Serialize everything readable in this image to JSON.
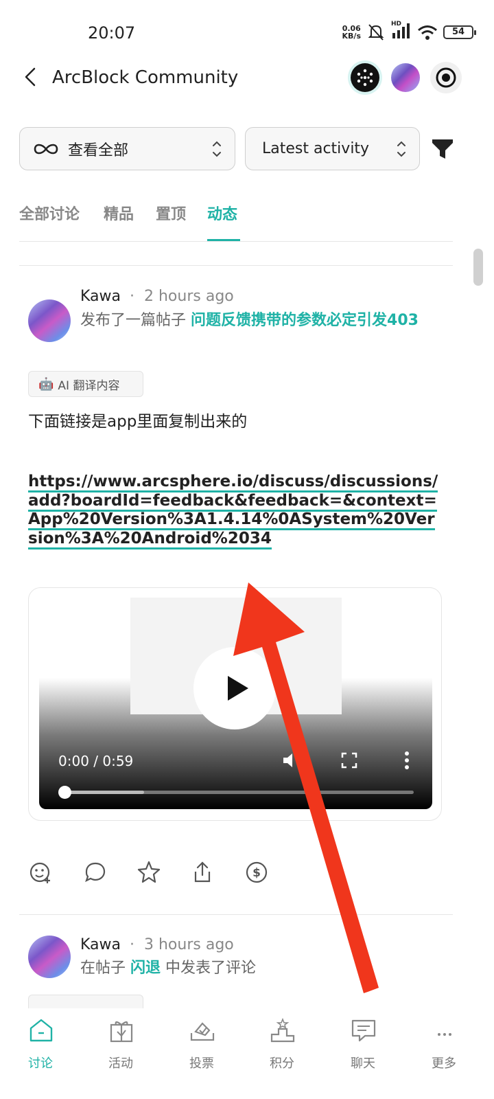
{
  "status_bar": {
    "time": "20:07",
    "net_speed_value": "0.06",
    "net_speed_unit": "KB/s",
    "signal_label": "HD",
    "battery": "54"
  },
  "header": {
    "title": "ArcBlock Community"
  },
  "filters": {
    "board_label": "查看全部",
    "sort_label": "Latest activity"
  },
  "tabs": [
    {
      "label": "全部讨论",
      "active": false
    },
    {
      "label": "精品",
      "active": false
    },
    {
      "label": "置顶",
      "active": false
    },
    {
      "label": "动态",
      "active": true
    }
  ],
  "feed": [
    {
      "author": "Kawa",
      "separator": "·",
      "time": "2 hours ago",
      "action_prefix": "发布了一篇帖子",
      "post_title": "问题反馈携带的参数必定引发403",
      "ai_badge": "AI 翻译内容",
      "text": "下面链接是app里面复制出来的",
      "link": "https://www.arcsphere.io/discuss/discussions/add?boardId=feedback&feedback=&context=App%20Version%3A1.4.14%0ASystem%20Version%3A%20Android%2034",
      "video": {
        "time_display": "0:00 / 0:59",
        "progress": 0,
        "buffered": 0.23
      },
      "actions": [
        "emoji-add-icon",
        "comment-icon",
        "star-icon",
        "share-icon",
        "tip-dollar-icon"
      ]
    },
    {
      "author": "Kawa",
      "separator": "·",
      "time": "3 hours ago",
      "action_prefix": "在帖子",
      "post_title": "闪退",
      "action_suffix": "中发表了评论"
    }
  ],
  "bottom_nav": [
    {
      "label": "讨论",
      "icon": "home-icon",
      "active": true
    },
    {
      "label": "活动",
      "icon": "gift-icon",
      "active": false
    },
    {
      "label": "投票",
      "icon": "ballot-icon",
      "active": false
    },
    {
      "label": "积分",
      "icon": "podium-icon",
      "active": false
    },
    {
      "label": "聊天",
      "icon": "chat-icon",
      "active": false
    },
    {
      "label": "更多",
      "icon": "more-icon",
      "active": false
    }
  ],
  "colors": {
    "accent": "#1fb2a6",
    "annotation_arrow": "#f0361c"
  }
}
